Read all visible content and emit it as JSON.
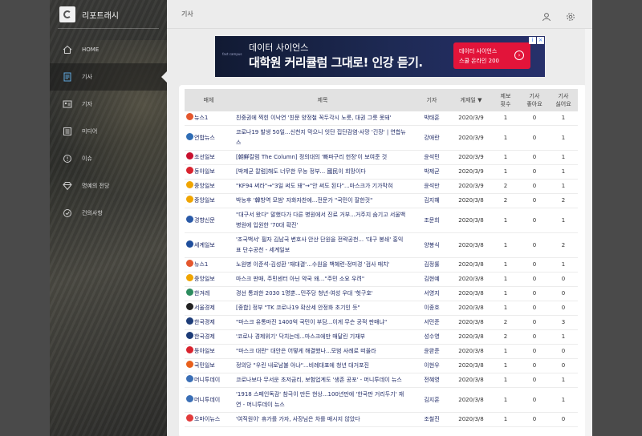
{
  "app": {
    "name": "리포트래시"
  },
  "nav": [
    {
      "label": "HOME",
      "icon": "home-icon"
    },
    {
      "label": "기사",
      "icon": "article-icon"
    },
    {
      "label": "기자",
      "icon": "reporter-icon"
    },
    {
      "label": "미디어",
      "icon": "media-icon"
    },
    {
      "label": "이슈",
      "icon": "issue-icon"
    },
    {
      "label": "명예의 전당",
      "icon": "diamond-icon"
    },
    {
      "label": "건의사항",
      "icon": "suggestion-icon"
    }
  ],
  "header": {
    "title": "기사",
    "icons": [
      "user-icon",
      "gear-icon"
    ]
  },
  "ad": {
    "logo": "fast campus",
    "line1": "데이터 사이언스",
    "line2": "대학원 커리큘럼 그대로! 인강 듣기.",
    "cta_line1": "데이터 사이언스",
    "cta_line2": "스쿨 온라인 200",
    "arrow": "›",
    "info": "i",
    "close": "×"
  },
  "table": {
    "headers": {
      "media": "매체",
      "title": "제목",
      "reporter": "기자",
      "date": "게재일 ▼",
      "reports": "제보\n횟수",
      "likes": "기사\n좋아요",
      "dislikes": "기사\n싫어요"
    },
    "rows": [
      {
        "media": "뉴스1",
        "logo": "#e4572e",
        "title": "친중권에 찍힌 이낙연 '친문 양정철 꼭두각시 노릇, 대권 그릇 못돼'",
        "reporter": "박태훈",
        "date": "2020/3/9",
        "reports": "1",
        "likes": "0",
        "dislikes": "1"
      },
      {
        "media": "연합뉴스",
        "logo": "#2f6db5",
        "title": "코로나19 발생 50일...신천지 막으니 잇단 집단감염·사망 '긴장' | 연합뉴스",
        "reporter": "강애란",
        "date": "2020/3/9",
        "reports": "1",
        "likes": "0",
        "dislikes": "1"
      },
      {
        "media": "조선일보",
        "logo": "#c8102e",
        "title": "[朝鮮칼럼 The Column] 정의대의 '빠파구리 헌정'이 보여준 것",
        "reporter": "윤석민",
        "date": "2020/3/9",
        "reports": "1",
        "likes": "0",
        "dislikes": "1"
      },
      {
        "media": "동아일보",
        "logo": "#d9232e",
        "title": "[박제균 칼럼]해도 너무한 무능 정부... 國民이 희망이다",
        "reporter": "박제균",
        "date": "2020/3/9",
        "reports": "1",
        "likes": "0",
        "dislikes": "1"
      },
      {
        "media": "중앙일보",
        "logo": "#f0a500",
        "title": "\"KF94 써라\"→\"3일 써도 돼\"→\"안 써도 된다\"...마스크가 기가막혀",
        "reporter": "윤석만",
        "date": "2020/3/9",
        "reports": "2",
        "likes": "0",
        "dislikes": "1"
      },
      {
        "media": "중앙일보",
        "logo": "#f0a500",
        "title": "박능후 '韓방역 모범' 자화자찬에...전문가 \"국민이 잘한것\"",
        "reporter": "김지혜",
        "date": "2020/3/8",
        "reports": "2",
        "likes": "0",
        "dislikes": "2"
      },
      {
        "media": "경향신문",
        "logo": "#2a5aa8",
        "title": "\"대구서 왔다\" 말했다가 다른 병원에서 진료 거부...거주지 숨기고 서울백병원에 입원한 '70대 확진'",
        "reporter": "조문희",
        "date": "2020/3/8",
        "reports": "1",
        "likes": "0",
        "dislikes": "1"
      },
      {
        "media": "세계일보",
        "logo": "#1f4e9c",
        "title": "'조국백서' 필자 김남국 변호사 안산 단원을 전략공천... '대구 봉쇄' 홍익표 단수공천 - 세계일보",
        "reporter": "양봉식",
        "date": "2020/3/8",
        "reports": "1",
        "likes": "0",
        "dislikes": "2"
      },
      {
        "media": "뉴스1",
        "logo": "#e4572e",
        "title": "노원병 이준석-김성환 '재대결'...수원을 백혜련-정미경 '검사 매치'",
        "reporter": "김정률",
        "date": "2020/3/8",
        "reports": "1",
        "likes": "0",
        "dislikes": "1"
      },
      {
        "media": "중앙일보",
        "logo": "#f0a500",
        "title": "마스크 판매, 주민센터 아닌 약국 왜…\"주민 소요 우려\"",
        "reporter": "김현예",
        "date": "2020/3/8",
        "reports": "1",
        "likes": "0",
        "dislikes": "0"
      },
      {
        "media": "한겨레",
        "logo": "#2d8c5f",
        "title": "경선 통과한 2030 1명뿐...민주당 청년·여성 우대 '헛구호'",
        "reporter": "서영지",
        "date": "2020/3/8",
        "reports": "1",
        "likes": "0",
        "dislikes": "0"
      },
      {
        "media": "서울경제",
        "logo": "#222222",
        "title": "[종합] 정부 \"TK 코로나19 확산세 안정화 초기인 듯\"",
        "reporter": "이종호",
        "date": "2020/3/8",
        "reports": "1",
        "likes": "0",
        "dislikes": "0"
      },
      {
        "media": "한국경제",
        "logo": "#1d3c78",
        "title": "\"마스크 유통마진 1400억 국민이 부담...이게 무슨 공적 판매냐\"",
        "reporter": "서민준",
        "date": "2020/3/8",
        "reports": "2",
        "likes": "0",
        "dislikes": "3"
      },
      {
        "media": "한국경제",
        "logo": "#1d3c78",
        "title": "'코로나 경제위기' 닥치는데...마스크에만 매달린 기재부",
        "reporter": "성수영",
        "date": "2020/3/8",
        "reports": "2",
        "likes": "0",
        "dislikes": "1"
      },
      {
        "media": "동아일보",
        "logo": "#d9232e",
        "title": "\"마스크 대란\" 대안은 어떻게 해결했나...모범 사례로 떠올라",
        "reporter": "윤완준",
        "date": "2020/3/8",
        "reports": "1",
        "likes": "0",
        "dislikes": "0"
      },
      {
        "media": "국민일보",
        "logo": "#e8601c",
        "title": "정의당 \"우린 내로남불 아냐\"...비례대표에 청년 대거포진",
        "reporter": "이현우",
        "date": "2020/3/8",
        "reports": "1",
        "likes": "0",
        "dislikes": "0"
      },
      {
        "media": "머니투데이",
        "logo": "#3b6fb6",
        "title": "코로나보다 무서운 초저금리, 보험업계도 '생존 공포' - 머니투데이 뉴스",
        "reporter": "전혜영",
        "date": "2020/3/8",
        "reports": "1",
        "likes": "0",
        "dislikes": "1"
      },
      {
        "media": "머니투데이",
        "logo": "#3b6fb6",
        "title": "'1918 스페인독감' 참극이 만든 현상...100년만에 '한국판 거리두기' 재연 - 머니투데이 뉴스",
        "reporter": "김지훈",
        "date": "2020/3/8",
        "reports": "1",
        "likes": "0",
        "dislikes": "1"
      },
      {
        "media": "오마이뉴스",
        "logo": "#e23b3b",
        "title": "'여직원이' 휴가를 가자, 사장님은 차를 매시지 않았다",
        "reporter": "조철진",
        "date": "2020/3/8",
        "reports": "1",
        "likes": "0",
        "dislikes": "0"
      }
    ]
  }
}
